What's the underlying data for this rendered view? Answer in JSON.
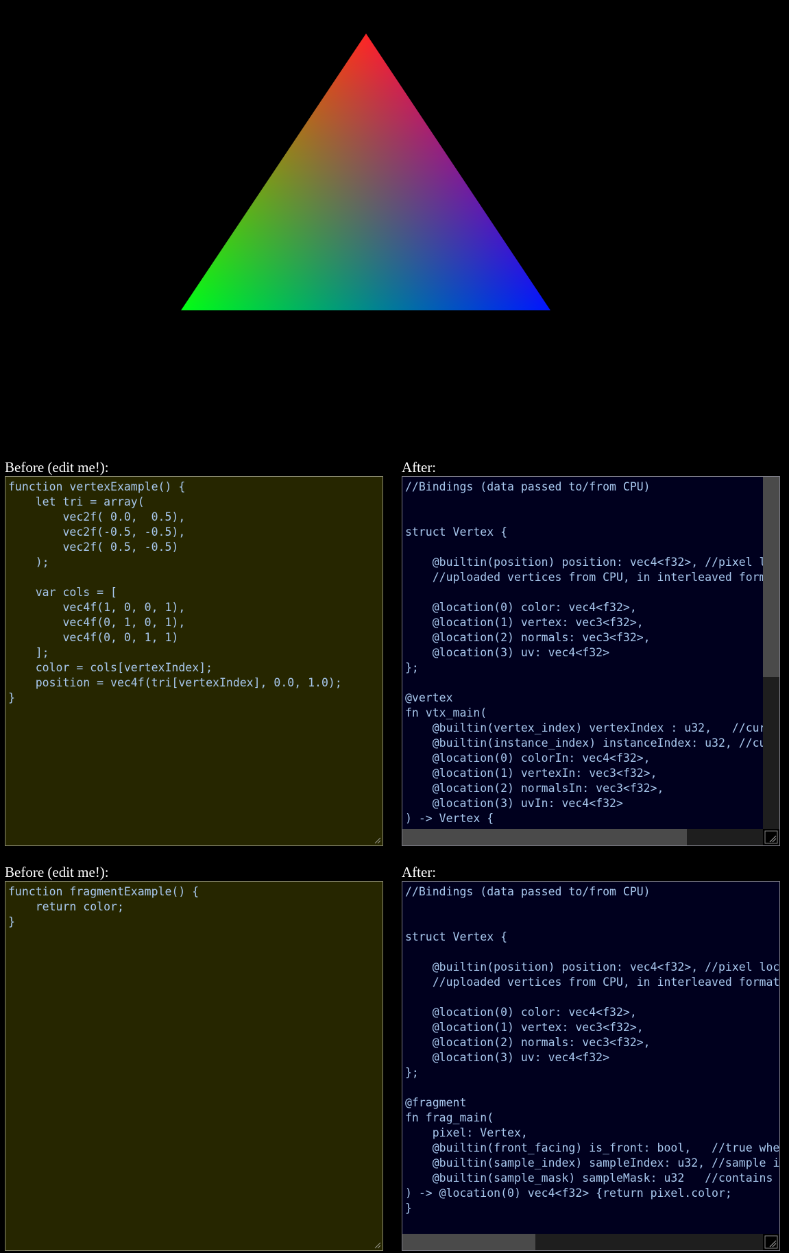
{
  "canvas": {
    "triangle_colors": [
      "#ff0000",
      "#00ff00",
      "#0000ff"
    ],
    "background": "#000000"
  },
  "vertex_section": {
    "before_label": "Before (edit me!):",
    "after_label": "After:",
    "before_code": "function vertexExample() {\n    let tri = array(\n        vec2f( 0.0,  0.5),\n        vec2f(-0.5, -0.5),\n        vec2f( 0.5, -0.5)\n    );\n\n    var cols = [\n        vec4f(1, 0, 0, 1),\n        vec4f(0, 1, 0, 1),\n        vec4f(0, 0, 1, 1)\n    ];\n    color = cols[vertexIndex];\n    position = vec4f(tri[vertexIndex], 0.0, 1.0);\n}",
    "after_code": "//Bindings (data passed to/from CPU)\n\n\nstruct Vertex {\n\n    @builtin(position) position: vec4<f32>, //pixel l\n    //uploaded vertices from CPU, in interleaved form\n\n    @location(0) color: vec4<f32>,\n    @location(1) vertex: vec3<f32>,\n    @location(2) normals: vec3<f32>,\n    @location(3) uv: vec4<f32>\n};\n\n@vertex\nfn vtx_main(\n    @builtin(vertex_index) vertexIndex : u32,   //cur\n    @builtin(instance_index) instanceIndex: u32, //cu\n    @location(0) colorIn: vec4<f32>,\n    @location(1) vertexIn: vec3<f32>,\n    @location(2) normalsIn: vec3<f32>,\n    @location(3) uvIn: vec4<f32>\n) -> Vertex {"
  },
  "fragment_section": {
    "before_label": "Before (edit me!):",
    "after_label": "After:",
    "before_code": "function fragmentExample() {\n    return color;\n}",
    "after_code": "//Bindings (data passed to/from CPU)\n\n\nstruct Vertex {\n\n    @builtin(position) position: vec4<f32>, //pixel loc\n    //uploaded vertices from CPU, in interleaved format\n\n    @location(0) color: vec4<f32>,\n    @location(1) vertex: vec3<f32>,\n    @location(2) normals: vec3<f32>,\n    @location(3) uv: vec4<f32>\n};\n\n@fragment\nfn frag_main(\n    pixel: Vertex,\n    @builtin(front_facing) is_front: bool,   //true whe\n    @builtin(sample_index) sampleIndex: u32, //sample i\n    @builtin(sample_mask) sampleMask: u32   //contains \n) -> @location(0) vec4<f32> {return pixel.color;\n}"
  },
  "theme": {
    "editor_bg": "#262600",
    "output_bg": "#00001e",
    "code_color": "#a8c8ee"
  }
}
